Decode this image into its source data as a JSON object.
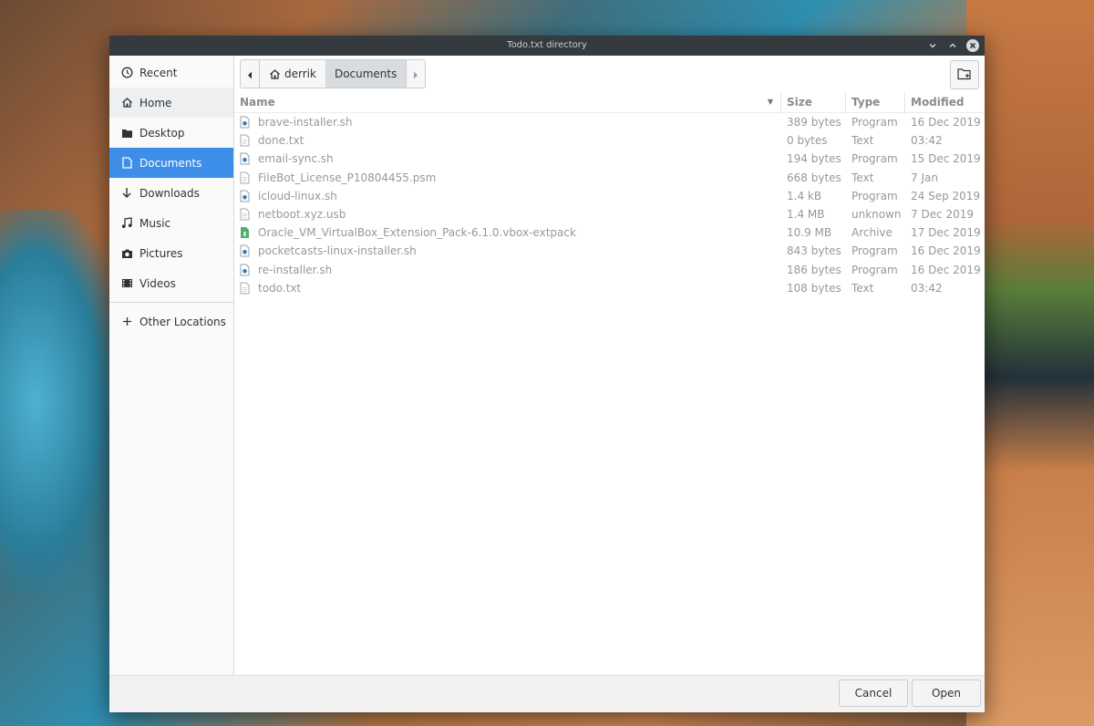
{
  "window": {
    "title": "Todo.txt directory"
  },
  "sidebar": {
    "items": [
      {
        "label": "Recent",
        "icon": "clock-icon"
      },
      {
        "label": "Home",
        "icon": "home-icon"
      },
      {
        "label": "Desktop",
        "icon": "folder-icon"
      },
      {
        "label": "Documents",
        "icon": "document-icon"
      },
      {
        "label": "Downloads",
        "icon": "download-arrow-icon"
      },
      {
        "label": "Music",
        "icon": "music-note-icon"
      },
      {
        "label": "Pictures",
        "icon": "camera-icon"
      },
      {
        "label": "Videos",
        "icon": "film-icon"
      }
    ],
    "other_locations": "Other Locations",
    "selected": "Documents"
  },
  "pathbar": {
    "crumbs": [
      "derrik",
      "Documents"
    ]
  },
  "columns": {
    "name": "Name",
    "size": "Size",
    "type": "Type",
    "modified": "Modified"
  },
  "files": [
    {
      "name": "brave-installer.sh",
      "size": "389 bytes",
      "type": "Program",
      "modified": "16 Dec 2019",
      "icon": "script-icon"
    },
    {
      "name": "done.txt",
      "size": "0 bytes",
      "type": "Text",
      "modified": "03:42",
      "icon": "text-file-icon"
    },
    {
      "name": "email-sync.sh",
      "size": "194 bytes",
      "type": "Program",
      "modified": "15 Dec 2019",
      "icon": "script-icon"
    },
    {
      "name": "FileBot_License_P10804455.psm",
      "size": "668 bytes",
      "type": "Text",
      "modified": "7 Jan",
      "icon": "text-file-icon"
    },
    {
      "name": "icloud-linux.sh",
      "size": "1.4 kB",
      "type": "Program",
      "modified": "24 Sep 2019",
      "icon": "script-icon"
    },
    {
      "name": "netboot.xyz.usb",
      "size": "1.4 MB",
      "type": "unknown",
      "modified": "7 Dec 2019",
      "icon": "text-file-icon"
    },
    {
      "name": "Oracle_VM_VirtualBox_Extension_Pack-6.1.0.vbox-extpack",
      "size": "10.9 MB",
      "type": "Archive",
      "modified": "17 Dec 2019",
      "icon": "archive-icon"
    },
    {
      "name": "pocketcasts-linux-installer.sh",
      "size": "843 bytes",
      "type": "Program",
      "modified": "16 Dec 2019",
      "icon": "script-icon"
    },
    {
      "name": "re-installer.sh",
      "size": "186 bytes",
      "type": "Program",
      "modified": "16 Dec 2019",
      "icon": "script-icon"
    },
    {
      "name": "todo.txt",
      "size": "108 bytes",
      "type": "Text",
      "modified": "03:42",
      "icon": "text-file-icon"
    }
  ],
  "buttons": {
    "cancel": "Cancel",
    "open": "Open"
  },
  "colors": {
    "accent": "#3d8ee8",
    "titlebar": "#353a3e",
    "archive": "#4caf6a"
  }
}
